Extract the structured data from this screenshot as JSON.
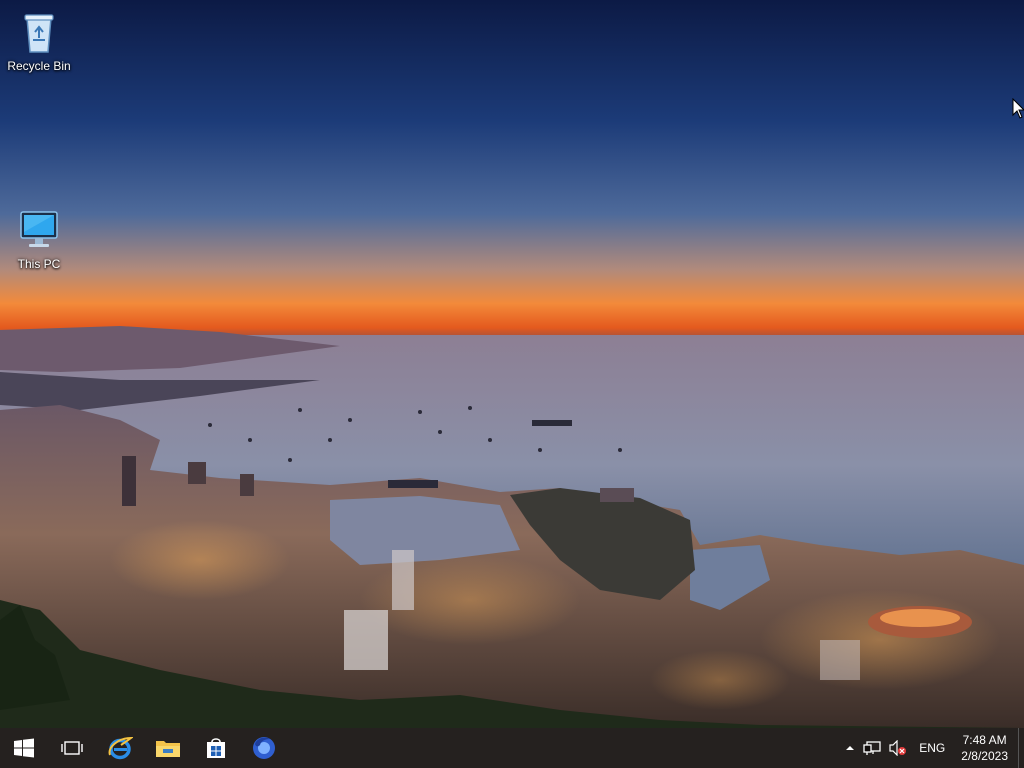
{
  "desktop": {
    "icons": [
      {
        "label": "Recycle Bin",
        "icon": "recycle-bin-icon"
      },
      {
        "label": "This PC",
        "icon": "this-pc-icon"
      }
    ]
  },
  "taskbar": {
    "pinned": [
      {
        "name": "start",
        "icon": "windows-logo-icon"
      },
      {
        "name": "task-view",
        "icon": "task-view-icon"
      },
      {
        "name": "internet-explorer",
        "icon": "internet-explorer-icon"
      },
      {
        "name": "file-explorer",
        "icon": "file-explorer-icon"
      },
      {
        "name": "store",
        "icon": "store-icon"
      },
      {
        "name": "firefox",
        "icon": "firefox-icon"
      }
    ],
    "tray": {
      "language": "ENG",
      "time": "7:48 AM",
      "date": "2/8/2023"
    }
  },
  "colors": {
    "sky_top": "#0f1f4d",
    "horizon": "#f07b2c",
    "sea": "#9c93a4",
    "taskbar": "#120e0c"
  }
}
